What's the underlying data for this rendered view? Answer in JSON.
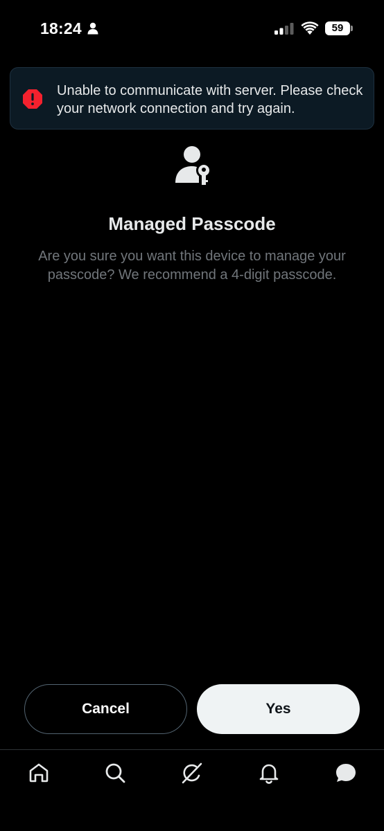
{
  "status_bar": {
    "time": "18:24",
    "battery": "59"
  },
  "error_banner": {
    "message": "Unable to communicate with server. Please check your network connection and try again.",
    "icon": "alert-octagon-icon",
    "color": "#f4212e"
  },
  "main": {
    "icon": "user-key-icon",
    "title": "Managed Passcode",
    "subtitle": "Are you sure you want this device to manage your passcode? We recommend a 4-digit passcode."
  },
  "actions": {
    "cancel_label": "Cancel",
    "yes_label": "Yes"
  },
  "tab_bar": {
    "items": [
      {
        "icon": "home-icon"
      },
      {
        "icon": "search-icon"
      },
      {
        "icon": "grok-icon"
      },
      {
        "icon": "bell-icon"
      },
      {
        "icon": "messages-icon"
      }
    ]
  }
}
